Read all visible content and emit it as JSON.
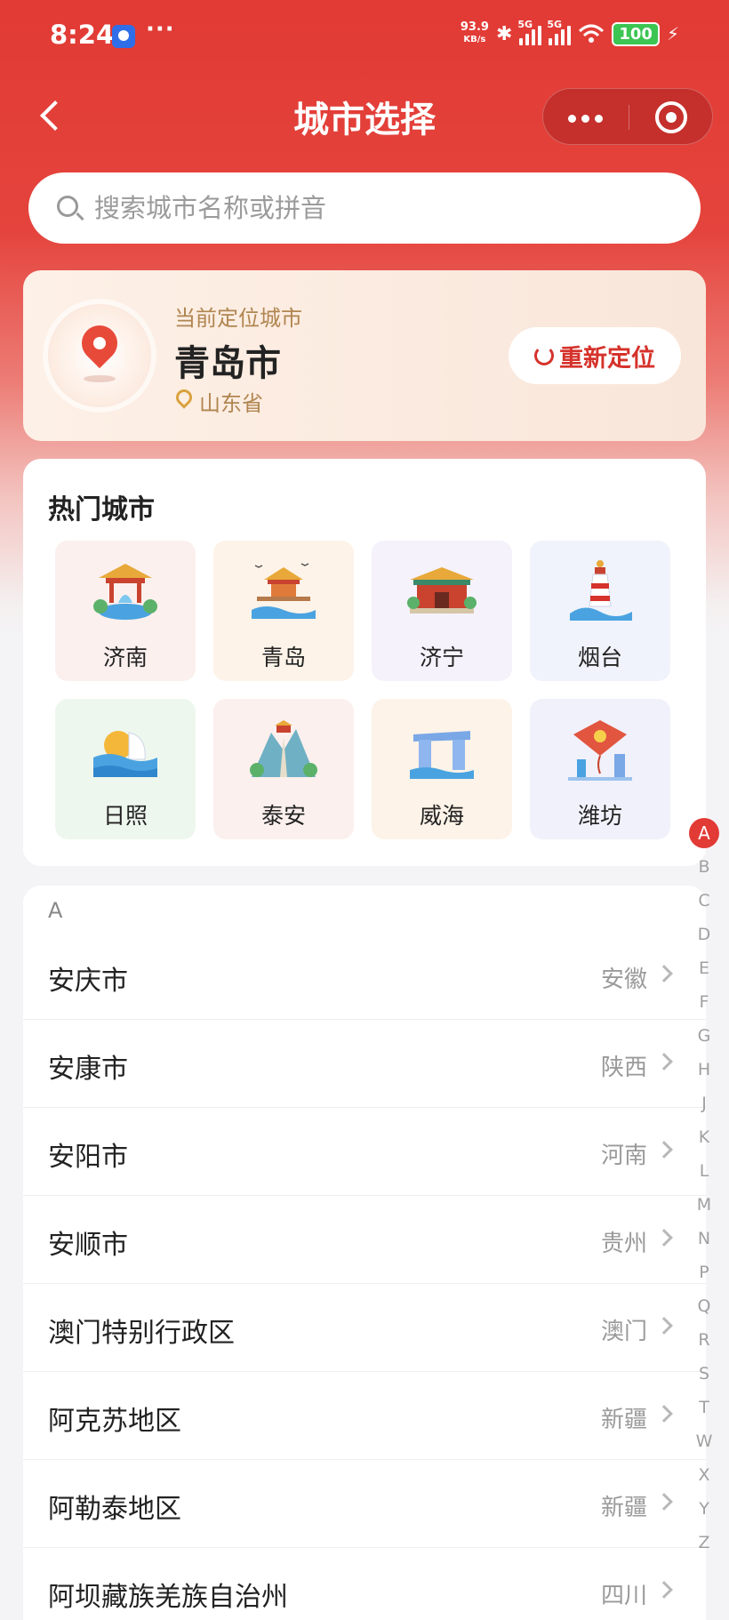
{
  "status_bar": {
    "time": "8:24",
    "dots": "···",
    "net_speed_value": "93.9",
    "net_speed_unit": "KB/s",
    "sig1_label": "5G",
    "sig2_label": "5G",
    "battery": "100"
  },
  "header": {
    "title": "城市选择"
  },
  "search": {
    "placeholder": "搜索城市名称或拼音",
    "value": ""
  },
  "location": {
    "caption": "当前定位城市",
    "city": "青岛市",
    "province": "山东省",
    "relocate_label": "重新定位"
  },
  "hot": {
    "title": "热门城市",
    "cities": [
      {
        "name": "济南",
        "bg": "#fbf0ee",
        "icon": "pavilion-fountain"
      },
      {
        "name": "青岛",
        "bg": "#fdf3e8",
        "icon": "pier-pavilion"
      },
      {
        "name": "济宁",
        "bg": "#f5f2fb",
        "icon": "temple-gate"
      },
      {
        "name": "烟台",
        "bg": "#f0f3fb",
        "icon": "lighthouse"
      },
      {
        "name": "日照",
        "bg": "#eef7ee",
        "icon": "sunrise-sea"
      },
      {
        "name": "泰安",
        "bg": "#fbf0ee",
        "icon": "mountain-temple"
      },
      {
        "name": "威海",
        "bg": "#fdf3e8",
        "icon": "gate-arch"
      },
      {
        "name": "潍坊",
        "bg": "#f1f1fb",
        "icon": "kite"
      }
    ]
  },
  "list": {
    "section": "A",
    "rows": [
      {
        "city": "安庆市",
        "province": "安徽"
      },
      {
        "city": "安康市",
        "province": "陕西"
      },
      {
        "city": "安阳市",
        "province": "河南"
      },
      {
        "city": "安顺市",
        "province": "贵州"
      },
      {
        "city": "澳门特别行政区",
        "province": "澳门"
      },
      {
        "city": "阿克苏地区",
        "province": "新疆"
      },
      {
        "city": "阿勒泰地区",
        "province": "新疆"
      },
      {
        "city": "阿坝藏族羌族自治州",
        "province": "四川"
      }
    ]
  },
  "index_letters": [
    "A",
    "B",
    "C",
    "D",
    "E",
    "F",
    "G",
    "H",
    "J",
    "K",
    "L",
    "M",
    "N",
    "P",
    "Q",
    "R",
    "S",
    "T",
    "W",
    "X",
    "Y",
    "Z"
  ],
  "colors": {
    "accent": "#e23a35"
  }
}
